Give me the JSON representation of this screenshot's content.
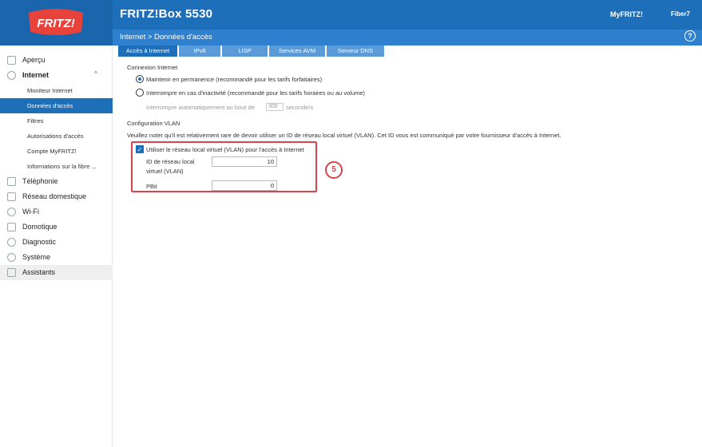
{
  "header": {
    "title": "FRITZ!Box 5530",
    "myfritz": "MyFRITZ!",
    "fiber": "Fiber7",
    "breadcrumb": "Internet > Données d'accès",
    "help_symbol": "?",
    "logo_text": "FRITZ!"
  },
  "tabs": [
    {
      "label": "Accès à Internet",
      "active": true
    },
    {
      "label": "IPv6"
    },
    {
      "label": "LISP"
    },
    {
      "label": "Services AVM"
    },
    {
      "label": "Serveur DNS"
    }
  ],
  "sidebar": {
    "items": [
      {
        "label": "Aperçu",
        "icon": "home-icon"
      },
      {
        "label": "Internet",
        "icon": "globe-icon",
        "expanded": true,
        "chevron": "^"
      },
      {
        "label": "Moniteur Internet"
      },
      {
        "label": "Données d'accès",
        "active": true
      },
      {
        "label": "Filtres"
      },
      {
        "label": "Autorisations d'accès"
      },
      {
        "label": "Compte MyFRITZ!"
      },
      {
        "label": "Informations sur la fibre ..."
      },
      {
        "label": "Téléphonie",
        "icon": "phone-icon"
      },
      {
        "label": "Réseau domestique",
        "icon": "network-icon"
      },
      {
        "label": "Wi-Fi",
        "icon": "wifi-icon"
      },
      {
        "label": "Domotique",
        "icon": "smarthome-icon"
      },
      {
        "label": "Diagnostic",
        "icon": "diagnostic-icon"
      },
      {
        "label": "Système",
        "icon": "system-icon"
      },
      {
        "label": "Assistants",
        "icon": "wizard-icon"
      }
    ]
  },
  "content": {
    "connection_title": "Connexion Internet",
    "radio_permanent": "Maintenir en permanence (recommandé pour les tarifs forfaitaires)",
    "radio_inactivity": "Interrompre en cas d'inactivité (recommandé pour les tarifs horaires ou au volume)",
    "auto_interrupt_label": "interrompre automatiquement au bout de",
    "auto_interrupt_value": "300",
    "auto_interrupt_unit": "seconde/s",
    "vlan_title": "Configuration VLAN",
    "vlan_note": "Veuillez noter qu'il est relativement rare de devoir utiliser un ID de réseau local virtuel (VLAN). Cet ID vous est communiqué par votre fournisseur d'accès à Internet.",
    "vlan_checkbox": "Utiliser le réseau local virtuel (VLAN) pour l'accès à Internet",
    "vlan_checkbox_checked": true,
    "vlan_id_label_1": "ID de réseau local",
    "vlan_id_label_2": "virtuel (VLAN)",
    "vlan_id_value": "10",
    "pbit_label": "PBit",
    "pbit_value": "0",
    "annotation_number": "5"
  },
  "colors": {
    "brand_blue": "#1e6fb9",
    "annotation_red": "#d9434b"
  }
}
